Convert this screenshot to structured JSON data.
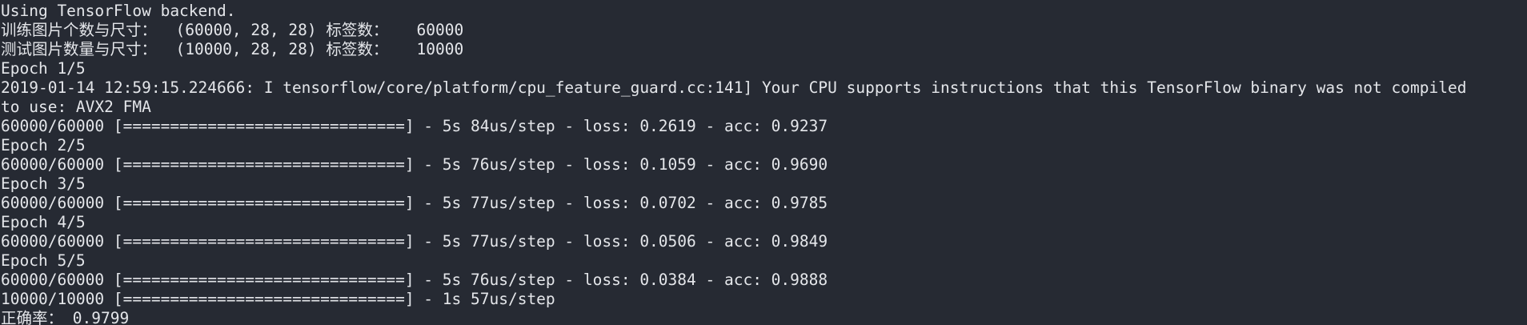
{
  "terminal": {
    "lines": [
      "Using TensorFlow backend.",
      "训练图片个数与尺寸：  (60000, 28, 28) 标签数：   60000",
      "测试图片数量与尺寸：  (10000, 28, 28) 标签数：   10000",
      "Epoch 1/5",
      "2019-01-14 12:59:15.224666: I tensorflow/core/platform/cpu_feature_guard.cc:141] Your CPU supports instructions that this TensorFlow binary was not compiled",
      "to use: AVX2 FMA",
      "60000/60000 [==============================] - 5s 84us/step - loss: 0.2619 - acc: 0.9237",
      "Epoch 2/5",
      "60000/60000 [==============================] - 5s 76us/step - loss: 0.1059 - acc: 0.9690",
      "Epoch 3/5",
      "60000/60000 [==============================] - 5s 77us/step - loss: 0.0702 - acc: 0.9785",
      "Epoch 4/5",
      "60000/60000 [==============================] - 5s 77us/step - loss: 0.0506 - acc: 0.9849",
      "Epoch 5/5",
      "60000/60000 [==============================] - 5s 76us/step - loss: 0.0384 - acc: 0.9888",
      "10000/10000 [==============================] - 1s 57us/step",
      "正确率： 0.9799"
    ],
    "colors": {
      "background": "#262a33",
      "text": "#e4e6ea"
    }
  }
}
